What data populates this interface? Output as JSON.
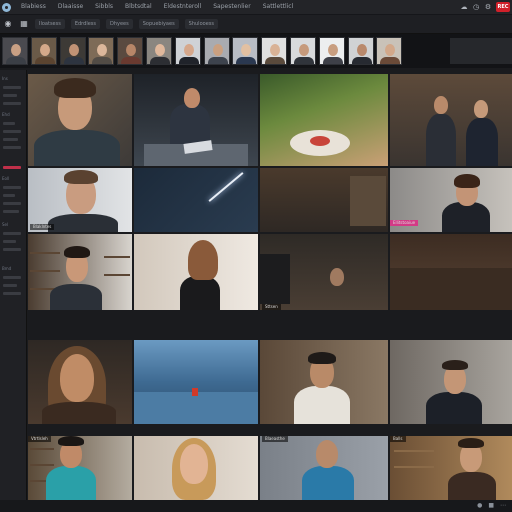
{
  "app": {
    "menu": [
      "Blabiess",
      "Dlaaisse",
      "Sibbls",
      "Blbtsdtal",
      "Eldestnteroll",
      "Sapestenlier",
      "Sattlettlicl"
    ]
  },
  "toolbar": {
    "rec_label": "REC",
    "icons": [
      "cloud-icon",
      "clock-icon",
      "settings-icon",
      "record-button"
    ]
  },
  "secondbar": {
    "tabs": [
      "Iloatsess",
      "Edrdless",
      "Dhyees",
      "Sopuebiyaes",
      "Shulooess"
    ]
  },
  "filmstrip": {
    "count": 14,
    "thumbs": [
      {
        "skin": "#c9a084",
        "shirt": "#3b3f46",
        "bg": "#4a4a4f"
      },
      {
        "skin": "#d4a98a",
        "shirt": "#5b4430",
        "bg": "#6a5a48"
      },
      {
        "skin": "#c09275",
        "shirt": "#2d3440",
        "bg": "#3d3a36"
      },
      {
        "skin": "#dcb79b",
        "shirt": "#524c46",
        "bg": "#7e6b57"
      },
      {
        "skin": "#b78668",
        "shirt": "#6a3a30",
        "bg": "#5a4a40"
      },
      {
        "skin": "#e0b89c",
        "shirt": "#2c2e33",
        "bg": "#8a8680"
      },
      {
        "skin": "#d6a88c",
        "shirt": "#20232a",
        "bg": "#cfd2d6"
      },
      {
        "skin": "#caa080",
        "shirt": "#3d434d",
        "bg": "#a9abb0"
      },
      {
        "skin": "#e2c0a2",
        "shirt": "#2a3850",
        "bg": "#b8bcc4"
      },
      {
        "skin": "#d9b296",
        "shirt": "#5a4a3c",
        "bg": "#e0e0e0"
      },
      {
        "skin": "#c69a7c",
        "shirt": "#30343b",
        "bg": "#d8dadc"
      },
      {
        "skin": "#c89e80",
        "shirt": "#3e4048",
        "bg": "#eceeef"
      },
      {
        "skin": "#b9896c",
        "shirt": "#272a31",
        "bg": "#d0d2d4"
      },
      {
        "skin": "#d2a88a",
        "shirt": "#6a4a38",
        "bg": "#c9c2b8"
      }
    ]
  },
  "sidebar": {
    "labels": [
      "Ins",
      "Ehd",
      "Eoll",
      "Sel",
      "Bmd"
    ]
  },
  "tiles": {
    "tags": [
      "Blaklntes",
      "Ellitstoaiue",
      "Sttsen",
      "Vtrtlsleh",
      "Blaeasthe",
      "Balls"
    ]
  },
  "colors": {
    "accent": "#d0202a",
    "sidebar_active": "#c0304a",
    "tag_pink": "#d33a86"
  }
}
